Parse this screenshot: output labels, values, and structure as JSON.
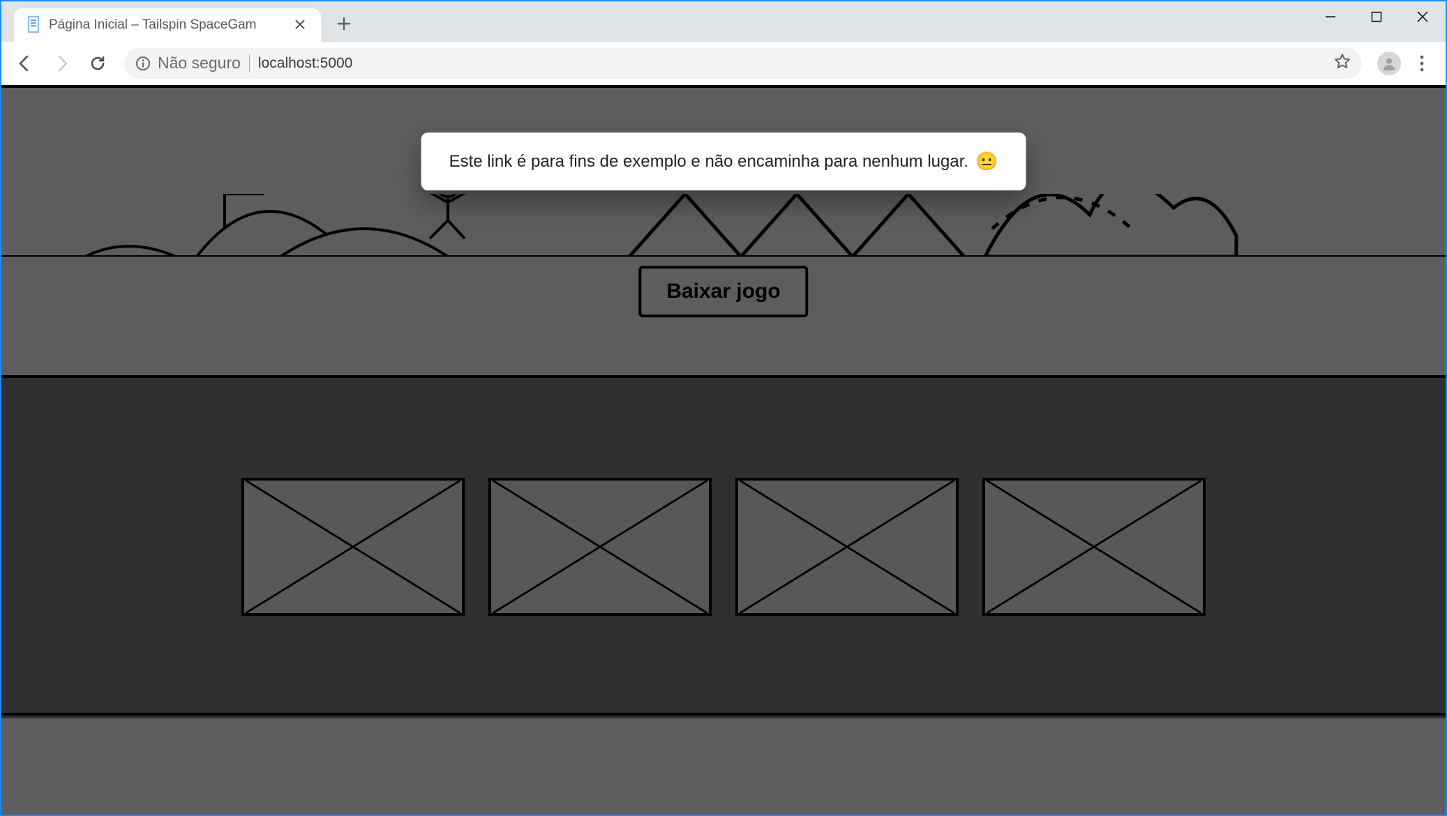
{
  "browser": {
    "tab_title": "Página Inicial – Tailspin SpaceGam",
    "security_label": "Não seguro",
    "url": "localhost:5000",
    "window_controls": {
      "minimize": "minimize-icon",
      "maximize": "maximize-icon",
      "close": "close-icon"
    }
  },
  "page": {
    "popup_text": "Este link é para fins de exemplo e não encaminha para nenhum lugar.",
    "popup_emoji": "😐",
    "download_label": "Baixar jogo",
    "thumbnail_count": 4
  },
  "colors": {
    "hero_bg": "#909090",
    "strip_bg": "#4a4a4a",
    "accent_border": "#000000",
    "popup_bg": "#ffffff"
  }
}
